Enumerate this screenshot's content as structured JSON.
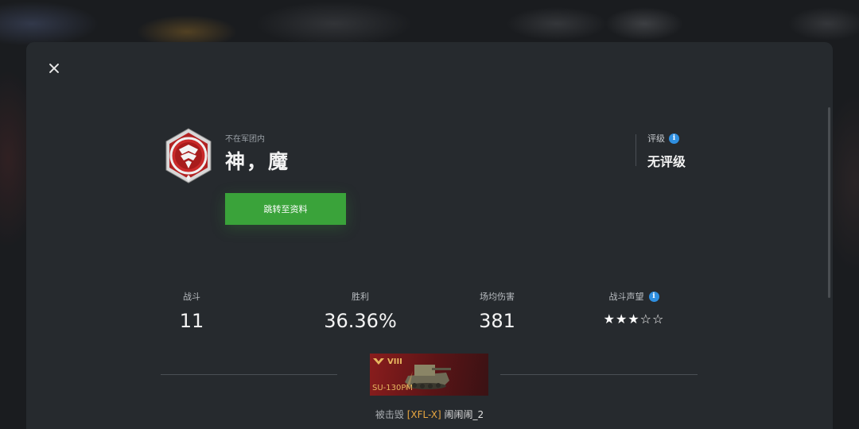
{
  "window": {
    "close_icon": "close-icon"
  },
  "player": {
    "clan_status": "不在军团内",
    "name": "神，魔",
    "profile_button": "跳转至资料",
    "emblem_icon": "rank-emblem-icon"
  },
  "rating": {
    "label": "评级",
    "info_icon": "i",
    "value": "无评级"
  },
  "stats": [
    {
      "label": "战斗",
      "value": "11"
    },
    {
      "label": "胜利",
      "value": "36.36%"
    },
    {
      "label": "场均伤害",
      "value": "381"
    },
    {
      "label": "战斗声望",
      "info_icon": "i",
      "stars": "★★★☆☆",
      "stars_filled": 3,
      "stars_total": 5
    }
  ],
  "destroyed_by": {
    "tank_tier": "VIII",
    "tank_name": "SU-130PM",
    "prefix": "被击毁",
    "clan_tag": "[XFL-X]",
    "nickname": "闹闹闹_2"
  },
  "colors": {
    "accent_green": "#3aa33a",
    "info_blue": "#2f8fe0",
    "clan_tag_orange": "#e8a640",
    "tank_card_red": "#8a1d1d"
  }
}
